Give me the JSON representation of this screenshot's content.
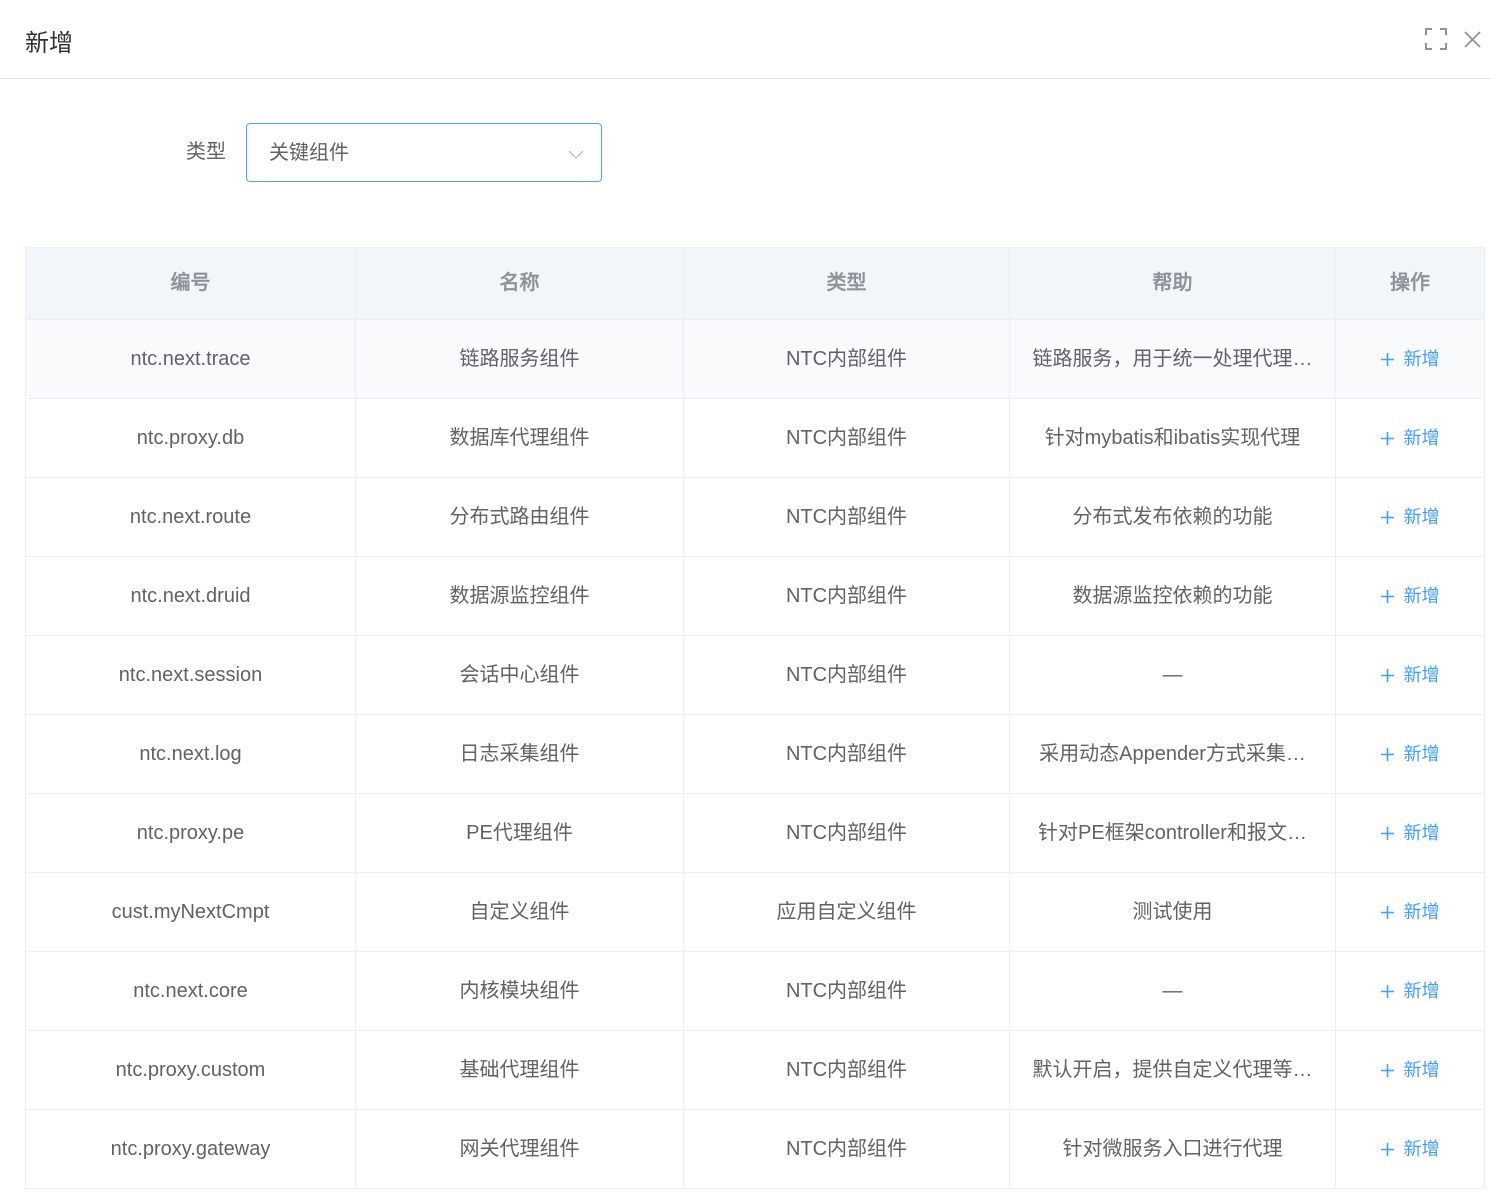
{
  "dialog": {
    "title": "新增",
    "fullscreen_icon": "fullscreen-icon",
    "close_icon": "close-icon"
  },
  "form": {
    "type_label": "类型",
    "type_value": "关键组件",
    "type_dropdown_icon": "chevron-down-icon"
  },
  "table": {
    "columns": {
      "code": "编号",
      "name": "名称",
      "type": "类型",
      "help": "帮助",
      "actions": "操作"
    },
    "action_icon": "plus-icon",
    "rows": [
      {
        "code": "ntc.next.trace",
        "name": "链路服务组件",
        "type": "NTC内部组件",
        "help": "链路服务，用于统一处理代理…",
        "action_label": "新增"
      },
      {
        "code": "ntc.proxy.db",
        "name": "数据库代理组件",
        "type": "NTC内部组件",
        "help": "针对mybatis和ibatis实现代理",
        "action_label": "新增"
      },
      {
        "code": "ntc.next.route",
        "name": "分布式路由组件",
        "type": "NTC内部组件",
        "help": "分布式发布依赖的功能",
        "action_label": "新增"
      },
      {
        "code": "ntc.next.druid",
        "name": "数据源监控组件",
        "type": "NTC内部组件",
        "help": "数据源监控依赖的功能",
        "action_label": "新增"
      },
      {
        "code": "ntc.next.session",
        "name": "会话中心组件",
        "type": "NTC内部组件",
        "help": "—",
        "action_label": "新增"
      },
      {
        "code": "ntc.next.log",
        "name": "日志采集组件",
        "type": "NTC内部组件",
        "help": "采用动态Appender方式采集…",
        "action_label": "新增"
      },
      {
        "code": "ntc.proxy.pe",
        "name": "PE代理组件",
        "type": "NTC内部组件",
        "help": "针对PE框架controller和报文…",
        "action_label": "新增"
      },
      {
        "code": "cust.myNextCmpt",
        "name": "自定义组件",
        "type": "应用自定义组件",
        "help": "测试使用",
        "action_label": "新增"
      },
      {
        "code": "ntc.next.core",
        "name": "内核模块组件",
        "type": "NTC内部组件",
        "help": "—",
        "action_label": "新增"
      },
      {
        "code": "ntc.proxy.custom",
        "name": "基础代理组件",
        "type": "NTC内部组件",
        "help": "默认开启，提供自定义代理等…",
        "action_label": "新增"
      },
      {
        "code": "ntc.proxy.gateway",
        "name": "网关代理组件",
        "type": "NTC内部组件",
        "help": "针对微服务入口进行代理",
        "action_label": "新增"
      }
    ]
  },
  "colors": {
    "accent": "#409eff",
    "text": "#606266",
    "title": "#303133",
    "header_text": "#909399",
    "header_bg": "#f2f5f9",
    "border": "#ebeef5",
    "select_border": "#4da3e8"
  }
}
